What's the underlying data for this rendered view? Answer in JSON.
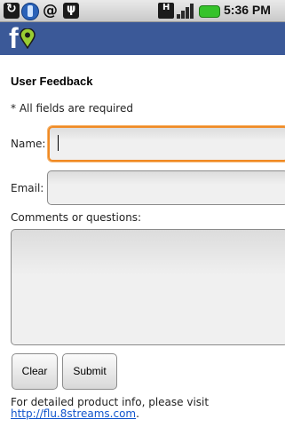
{
  "status_bar": {
    "time": "5:36 PM",
    "icons": [
      "sync-icon",
      "phone-icon",
      "at-icon",
      "usb-icon",
      "hsdpa-icon",
      "signal-icon",
      "battery-icon"
    ]
  },
  "app_bar": {
    "logo_text": "f",
    "accent": "#3b5998",
    "pin_color": "#9acd32"
  },
  "form": {
    "title": "User Feedback",
    "required_note": "* All fields are required",
    "name_label": "Name:",
    "name_value": "",
    "email_label": "Email:",
    "email_value": "",
    "comments_label": "Comments or questions:",
    "comments_value": "",
    "clear_label": "Clear",
    "submit_label": "Submit"
  },
  "footer": {
    "text": "For detailed product info, please visit",
    "link": "http://flu.8streams.com",
    "suffix": "."
  }
}
